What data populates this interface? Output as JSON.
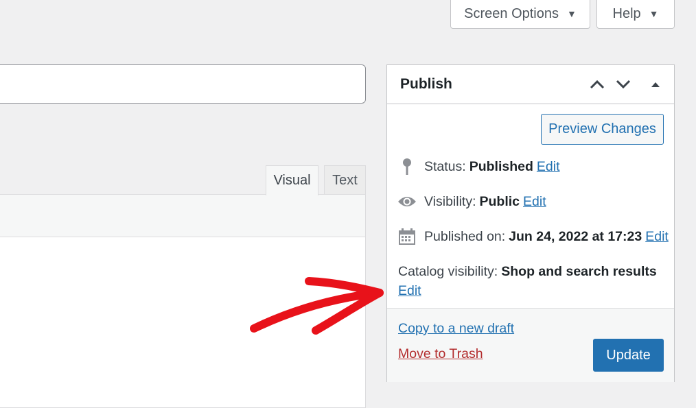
{
  "screen_meta": {
    "screen_options_label": "Screen Options",
    "help_label": "Help"
  },
  "editor": {
    "title_value": "",
    "tabs": [
      {
        "label": "Visual",
        "active": true
      },
      {
        "label": "Text",
        "active": false
      }
    ]
  },
  "publish": {
    "title": "Publish",
    "preview_label": "Preview Changes",
    "status": {
      "label": "Status:",
      "value": "Published",
      "edit": "Edit",
      "icon": "pin-icon"
    },
    "visibility": {
      "label": "Visibility:",
      "value": "Public",
      "edit": "Edit",
      "icon": "eye-icon"
    },
    "published_on": {
      "label": "Published on:",
      "value": "Jun 24, 2022 at 17:23",
      "edit": "Edit",
      "icon": "calendar-icon"
    },
    "catalog_visibility": {
      "label": "Catalog visibility:",
      "value": "Shop and search results",
      "edit": "Edit"
    },
    "copy_draft_label": "Copy to a new draft",
    "trash_label": "Move to Trash",
    "update_label": "Update"
  },
  "colors": {
    "accent": "#2271b1",
    "danger": "#b32d2e",
    "annotation": "#e8121a"
  }
}
